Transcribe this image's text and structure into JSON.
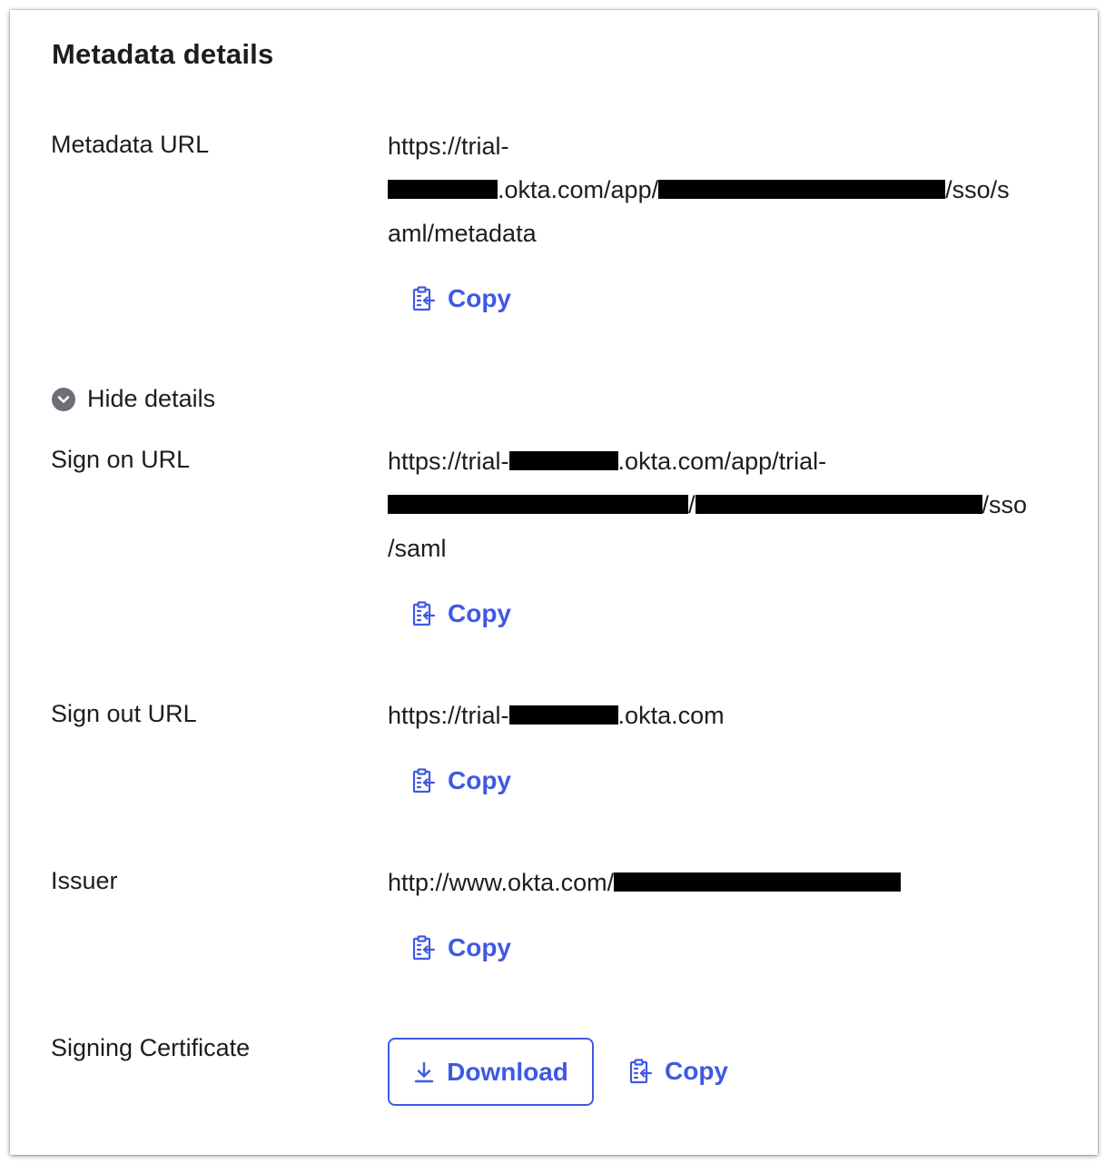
{
  "title": "Metadata details",
  "colors": {
    "accent": "#3f59e4",
    "text": "#1d1d21",
    "redaction": "#000000"
  },
  "copy_label": "Copy",
  "fields": {
    "metadata_url": {
      "label": "Metadata URL",
      "line1": "https://trial-",
      "line2_a": ".okta.com/app/",
      "line2_b": "/sso/s",
      "line3": "aml/metadata"
    },
    "sign_on_url": {
      "label": "Sign on URL",
      "line1_a": "https://trial-",
      "line1_b": ".okta.com/app/trial-",
      "line2_a": "/",
      "line2_b": "/sso",
      "line3": "/saml"
    },
    "sign_out_url": {
      "label": "Sign out URL",
      "line1_a": "https://trial-",
      "line1_b": ".okta.com"
    },
    "issuer": {
      "label": "Issuer",
      "line1_a": "http://www.okta.com/"
    },
    "signing_certificate": {
      "label": "Signing Certificate",
      "download_label": "Download"
    }
  },
  "toggle": {
    "label": "Hide details",
    "icon": "chevron-down-circle-icon"
  }
}
